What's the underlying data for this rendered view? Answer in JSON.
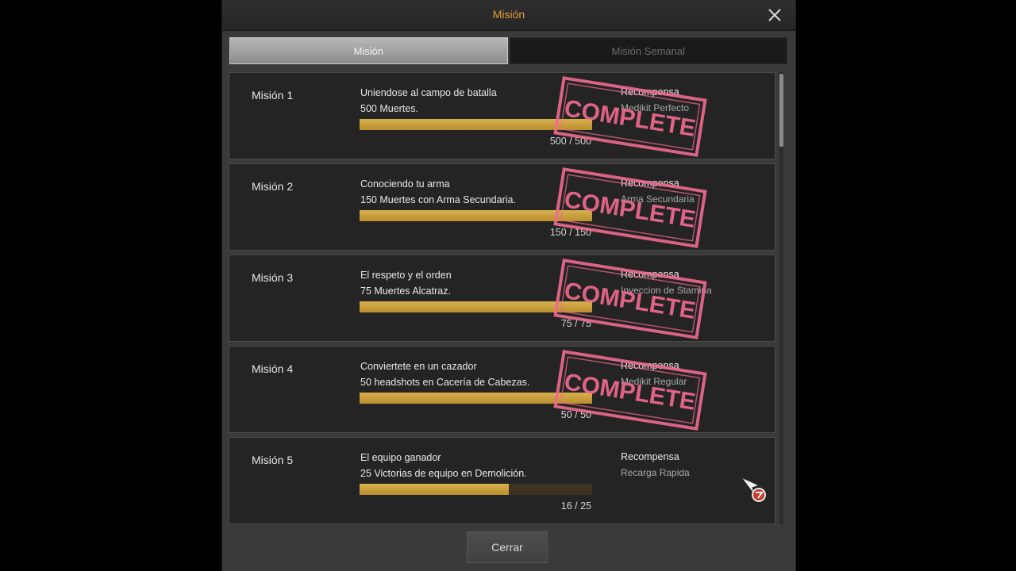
{
  "window": {
    "title": "Misión",
    "close_label": "Cerrar"
  },
  "tabs": [
    {
      "label": "Misión",
      "active": true
    },
    {
      "label": "Misión Semanal",
      "active": false
    }
  ],
  "reward_heading": "Recompensa",
  "stamp_text": "COMPLETE",
  "missions": [
    {
      "label": "Misión 1",
      "name": "Uniendose al campo de batalla",
      "description": "500 Muertes.",
      "progress": 500,
      "goal": 500,
      "progress_text": "500 / 500",
      "reward": "Medikit Perfecto",
      "complete": true
    },
    {
      "label": "Misión 2",
      "name": "Conociendo tu arma",
      "description": "150 Muertes con Arma Secundaria.",
      "progress": 150,
      "goal": 150,
      "progress_text": "150 / 150",
      "reward": "Arma Secundaria",
      "complete": true
    },
    {
      "label": "Misión 3",
      "name": "El respeto y el orden",
      "description": "75 Muertes Alcatraz.",
      "progress": 75,
      "goal": 75,
      "progress_text": "75 / 75",
      "reward": "Inyeccion de Stamina",
      "complete": true
    },
    {
      "label": "Misión 4",
      "name": "Conviertete en un cazador",
      "description": "50 headshots en Cacería de Cabezas.",
      "progress": 50,
      "goal": 50,
      "progress_text": "50 / 50",
      "reward": "Medikit Regular",
      "complete": true
    },
    {
      "label": "Misión 5",
      "name": "El equipo ganador",
      "description": "25 Victorias de equipo en Demolición.",
      "progress": 16,
      "goal": 25,
      "progress_text": "16 / 25",
      "reward": "Recarga Rapida",
      "complete": false
    }
  ],
  "colors": {
    "accent": "#e79a3c",
    "progress": "#c9a03c",
    "stamp": "#f06a8f"
  }
}
